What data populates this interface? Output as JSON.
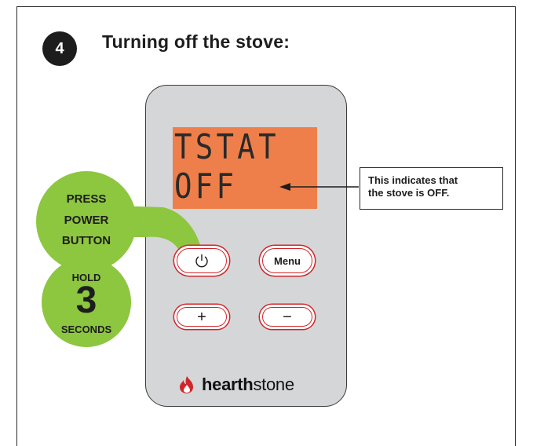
{
  "step": {
    "number": "4",
    "title": "Turning off the stove:"
  },
  "display": {
    "line1": "TSTAT",
    "line2": "OFF"
  },
  "callout": {
    "line1": "This indicates that",
    "line2": "the stove is OFF."
  },
  "buttons": {
    "power": "⏻",
    "menu": "Menu",
    "plus": "+",
    "minus": "−"
  },
  "instruction_press": {
    "line1": "PRESS",
    "line2": "POWER",
    "line3": "BUTTON"
  },
  "instruction_hold": {
    "line1": "HOLD",
    "number": "3",
    "line2": "SECONDS"
  },
  "brand": {
    "bold": "hearth",
    "regular": "stone"
  },
  "colors": {
    "green": "#8dc63f",
    "display": "#ef7f4a",
    "panel": "#d5d6d8",
    "button_border": "#d0262b",
    "flame": "#d0262b"
  }
}
